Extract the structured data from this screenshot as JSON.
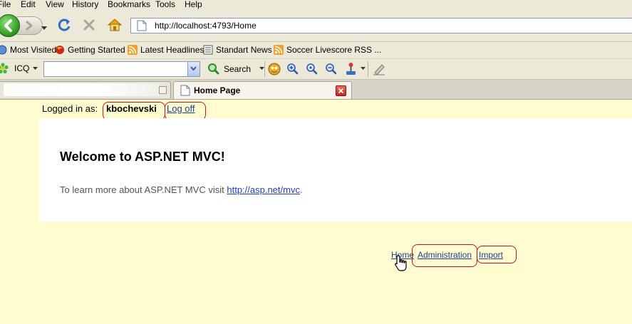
{
  "menu": {
    "items": [
      "File",
      "Edit",
      "View",
      "History",
      "Bookmarks",
      "Tools",
      "Help"
    ]
  },
  "address": {
    "url": "http://localhost:4793/Home"
  },
  "bookmarks": {
    "items": [
      "Most Visited",
      "Getting Started",
      "Latest Headlines",
      "Standart News",
      "Soccer Livescore RSS ..."
    ]
  },
  "toolbar": {
    "icq_label": "ICQ",
    "search_label": "Search",
    "search_value": ""
  },
  "tabs": {
    "inactive_title": "",
    "active_title": "Home Page"
  },
  "page": {
    "login_prefix": "Logged in as:",
    "username": "kbochevski",
    "logoff": "Log off",
    "heading": "Welcome to ASP.NET MVC!",
    "intro_text": "To learn more about ASP.NET MVC visit",
    "intro_link": "http://asp.net/mvc",
    "intro_period": ".",
    "nav": [
      "Home",
      "Administration",
      "Import"
    ]
  },
  "colors": {
    "page_bg": "#fffdd0",
    "link": "#1f3f8f",
    "annotation": "#c8102e",
    "chrome": "#ece9d8"
  }
}
